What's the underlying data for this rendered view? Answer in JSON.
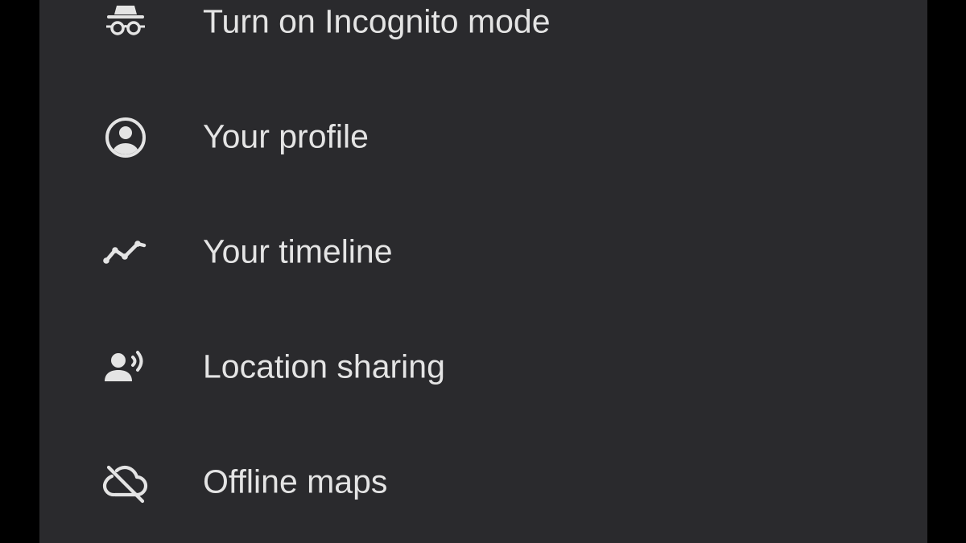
{
  "menu": {
    "items": [
      {
        "label": "Turn on Incognito mode",
        "icon": "incognito-icon"
      },
      {
        "label": "Your profile",
        "icon": "account-circle-icon"
      },
      {
        "label": "Your timeline",
        "icon": "timeline-icon"
      },
      {
        "label": "Location sharing",
        "icon": "location-sharing-icon"
      },
      {
        "label": "Offline maps",
        "icon": "cloud-off-icon"
      }
    ]
  },
  "colors": {
    "background": "#000000",
    "panel": "#2a2a2d",
    "text": "#e4e4e4",
    "icon": "#e4e4e4"
  }
}
